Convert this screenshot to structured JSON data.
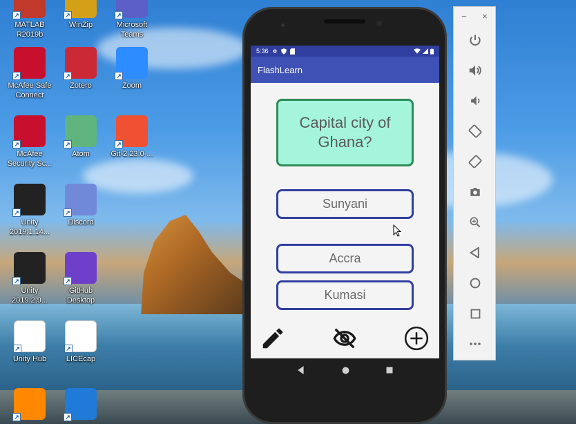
{
  "desktop": {
    "icons": [
      {
        "label": "MATLAB R2019b",
        "icon": "matlab-icon",
        "color": "#c0392b"
      },
      {
        "label": "WinZip",
        "icon": "winzip-icon",
        "color": "#d4a017"
      },
      {
        "label": "Microsoft Teams",
        "icon": "teams-icon",
        "color": "#5b5fc7"
      },
      {
        "label": "McAfee Safe Connect",
        "icon": "mcafee-safe-connect-icon",
        "color": "#c8102e"
      },
      {
        "label": "Zotero",
        "icon": "zotero-icon",
        "color": "#cc2936"
      },
      {
        "label": "Zoom",
        "icon": "zoom-icon",
        "color": "#2d8cff"
      },
      {
        "label": "McAfee Security Sc...",
        "icon": "mcafee-security-icon",
        "color": "#c8102e"
      },
      {
        "label": "Atom",
        "icon": "atom-icon",
        "color": "#5fb57d"
      },
      {
        "label": "Git-2.23.0-...",
        "icon": "git-icon",
        "color": "#f05133"
      },
      {
        "label": "Unity 2019.1.14...",
        "icon": "unity-icon",
        "color": "#222222"
      },
      {
        "label": "Discord",
        "icon": "discord-icon",
        "color": "#7289da"
      },
      {
        "label": "Unity 2019.2.9...",
        "icon": "unity-icon",
        "color": "#222222"
      },
      {
        "label": "GitHub Desktop",
        "icon": "github-desktop-icon",
        "color": "#6e40c9"
      },
      {
        "label": "Unity Hub",
        "icon": "unity-hub-icon",
        "color": "#ffffff"
      },
      {
        "label": "LICEcap",
        "icon": "licecap-icon",
        "color": "#ffffff"
      },
      {
        "label": "",
        "icon": "vlc-icon",
        "color": "#ff8800"
      },
      {
        "label": "",
        "icon": "edge-icon",
        "color": "#1f7ad8"
      }
    ]
  },
  "phone": {
    "status": {
      "time": "5:36",
      "icons": [
        "settings-icon",
        "shield-icon",
        "sim-icon"
      ],
      "right_icons": [
        "wifi-icon",
        "signal-icon",
        "battery-icon"
      ]
    },
    "app_title": "FlashLearn",
    "question": "Capital city of Ghana?",
    "answers": [
      "Sunyani",
      "Accra",
      "Kumasi"
    ],
    "toolbar": {
      "edit": "pencil-icon",
      "toggle": "eye-off-icon",
      "add": "add-circle-icon"
    },
    "nav": [
      "back-icon",
      "home-icon",
      "overview-icon"
    ],
    "colors": {
      "primary": "#3f51b5",
      "primary_dark": "#303f9f",
      "question_bg": "#a5f5dc",
      "question_border": "#2e8b57",
      "answer_border": "#303f9f"
    }
  },
  "emulator_panel": {
    "window_controls": [
      "−",
      "×"
    ],
    "buttons": [
      "power-icon",
      "volume-up-icon",
      "volume-down-icon",
      "rotate-left-icon",
      "rotate-right-icon",
      "camera-icon",
      "zoom-icon",
      "back-icon",
      "home-icon",
      "overview-icon",
      "more-icon"
    ]
  }
}
